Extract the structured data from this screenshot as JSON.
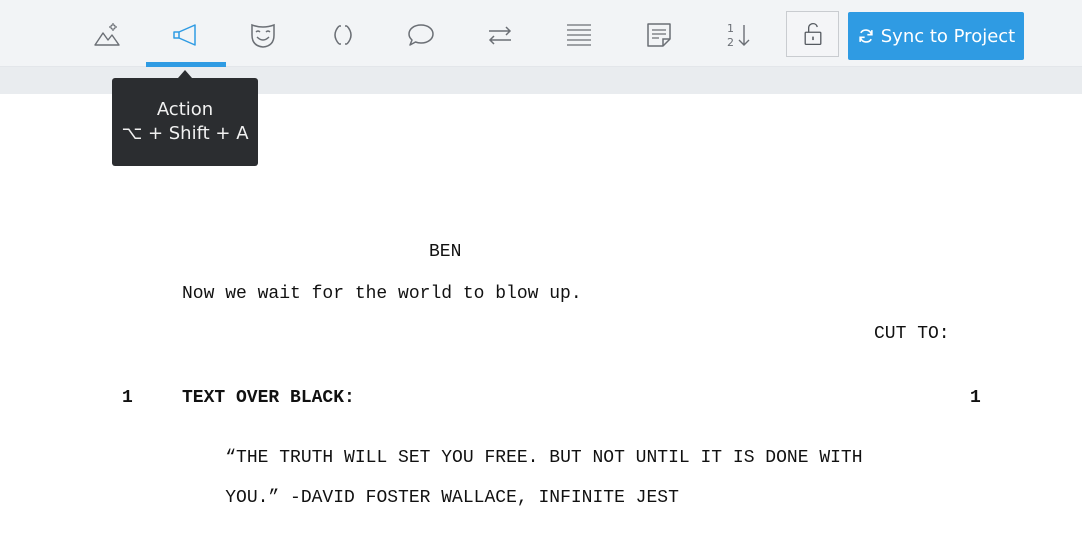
{
  "toolbar": {
    "tools": [
      {
        "name": "scene-heading",
        "icon": "mountain-scene-icon"
      },
      {
        "name": "action",
        "icon": "megaphone-icon",
        "active": true
      },
      {
        "name": "character",
        "icon": "mask-icon"
      },
      {
        "name": "parenthetical",
        "icon": "parentheses-icon"
      },
      {
        "name": "dialogue",
        "icon": "speech-bubble-icon"
      },
      {
        "name": "transition",
        "icon": "swap-arrows-icon"
      },
      {
        "name": "general",
        "icon": "lines-icon"
      },
      {
        "name": "note",
        "icon": "note-icon"
      },
      {
        "name": "numbering",
        "icon": "sort-numbers-icon",
        "num_top": "1",
        "num_bottom": "2"
      }
    ],
    "lock_icon": "unlock-icon",
    "sync_label": "Sync to Project",
    "accent_color": "#2f9be3"
  },
  "tooltip": {
    "title": "Action",
    "shortcut": "⌥ + Shift + A"
  },
  "script": {
    "character": "BEN",
    "dialogue": "Now we wait for the world to blow up.",
    "transition": "CUT TO:",
    "scene_number_left": "1",
    "scene_heading": "TEXT OVER BLACK:",
    "scene_number_right": "1",
    "action_line_1": "“THE TRUTH WILL SET YOU FREE. BUT NOT UNTIL IT IS DONE WITH",
    "action_line_2": "YOU.” -DAVID FOSTER WALLACE, INFINITE JEST"
  }
}
